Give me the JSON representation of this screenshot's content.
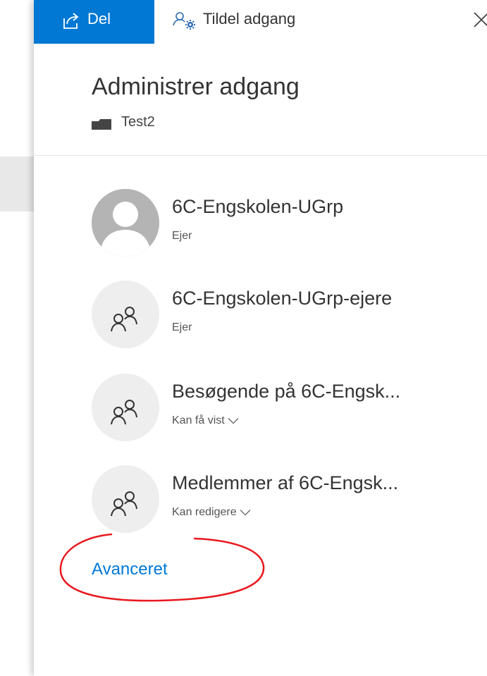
{
  "toolbar": {
    "share_label": "Del",
    "share_icon": "share-icon",
    "grant_label": "Tildel adgang",
    "grant_icon": "grant-access-icon",
    "close_icon": "close-icon"
  },
  "header": {
    "title": "Administrer adgang",
    "item_name": "Test2",
    "item_icon": "folder-icon"
  },
  "access_list": [
    {
      "name": "6C-Engskolen-UGrp",
      "role": "Ejer",
      "avatar": "person-avatar-icon",
      "has_dropdown": false
    },
    {
      "name": "6C-Engskolen-UGrp-ejere",
      "role": "Ejer",
      "avatar": "group-icon",
      "has_dropdown": false
    },
    {
      "name": "Besøgende på 6C-Engsk...",
      "role": "Kan få vist",
      "avatar": "group-icon",
      "has_dropdown": true
    },
    {
      "name": "Medlemmer af 6C-Engsk...",
      "role": "Kan redigere",
      "avatar": "group-icon",
      "has_dropdown": true
    }
  ],
  "advanced_link": "Avanceret",
  "colors": {
    "accent": "#0078d4",
    "annotation": "#e8181e"
  }
}
